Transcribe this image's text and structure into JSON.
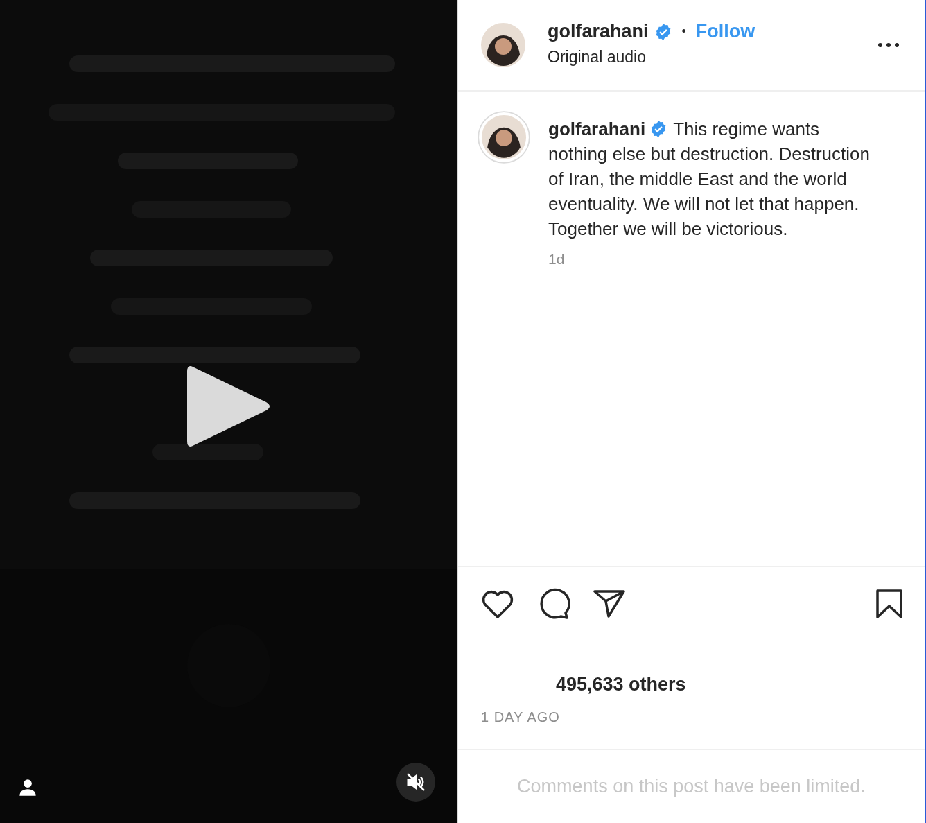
{
  "video": {
    "kind": "picture",
    "muted": true
  },
  "header": {
    "username": "golfarahani",
    "verified": true,
    "separator": "•",
    "follow": "Follow",
    "subtitle": "Original audio"
  },
  "caption": {
    "username": "golfarahani",
    "verified": true,
    "text": "This regime wants nothing else but destruction. Destruction of Iran, the middle East and the world eventuality. We will not let that happen. Together we will be victorious.",
    "time": "1d"
  },
  "likes": "495,633 others",
  "date": "1 DAY AGO",
  "comments_notice": "Comments on this post have been limited."
}
